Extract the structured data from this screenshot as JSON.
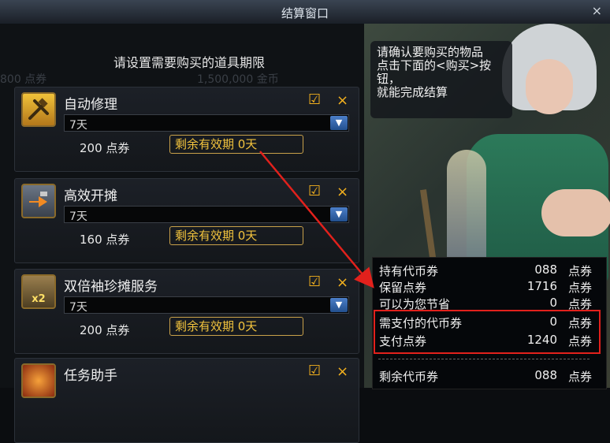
{
  "window": {
    "title": "结算窗口",
    "close": "×"
  },
  "background_ghost": {
    "price_left": "800 点券",
    "price_right": "1,500,000 金币"
  },
  "prompt": "请设置需要购买的道具期限",
  "items": [
    {
      "name": "自动修理",
      "duration": "7天",
      "price": "200 点券",
      "remaining": "剩余有效期 0天",
      "icon": "hammer-wrench-icon",
      "checked": "☑",
      "remove": "×"
    },
    {
      "name": "高效开摊",
      "duration": "7天",
      "price": "160 点券",
      "remaining": "剩余有效期 0天",
      "icon": "hammer-arrow-icon",
      "checked": "☑",
      "remove": "×"
    },
    {
      "name": "双倍袖珍摊服务",
      "duration": "7天",
      "price": "200 点券",
      "remaining": "剩余有效期 0天",
      "icon": "double-stall-icon",
      "badge": "x2",
      "checked": "☑",
      "remove": "×"
    },
    {
      "name": "任务助手",
      "icon": "task-helper-icon",
      "checked": "☑",
      "remove": "×"
    }
  ],
  "tip": "请确认要购买的物品\n点击下面的<购买>按钮，\n就能完成结算",
  "summary": [
    {
      "label": "持有代币券",
      "amount": "088",
      "unit": "点券"
    },
    {
      "label": "保留点券",
      "amount": "1716",
      "unit": "点券"
    },
    {
      "label": "可以为您节省",
      "amount": "0",
      "unit": "点券"
    },
    {
      "label": "需支付的代币券",
      "amount": "0",
      "unit": "点券"
    },
    {
      "label": "支付点券",
      "amount": "1240",
      "unit": "点券"
    },
    {
      "label": "剩余代币券",
      "amount": "088",
      "unit": "点券"
    }
  ],
  "colors": {
    "accent": "#f2b01e",
    "highlight": "#e2211c",
    "select_arrow": "#4b7ec8"
  }
}
